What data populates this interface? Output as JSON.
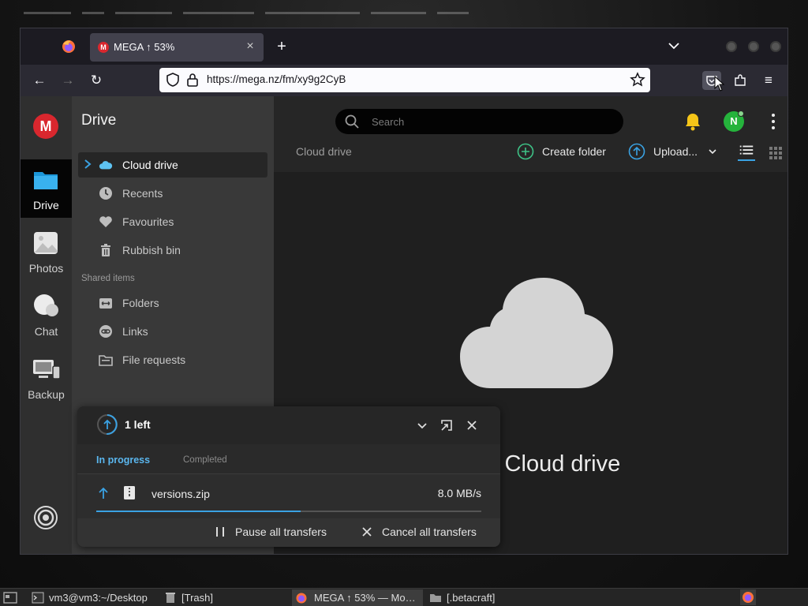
{
  "browser": {
    "tab_title": "MEGA ↑ 53%",
    "new_tab": "+",
    "url": "https://mega.nz/fm/xy9g2CyB"
  },
  "rail": {
    "logo": "M",
    "items": [
      {
        "label": "Drive",
        "active": true
      },
      {
        "label": "Photos"
      },
      {
        "label": "Chat"
      },
      {
        "label": "Backup"
      }
    ]
  },
  "sidebar": {
    "title": "Drive",
    "items": [
      {
        "label": "Cloud drive",
        "icon": "cloud-icon",
        "active": true
      },
      {
        "label": "Recents",
        "icon": "clock-icon"
      },
      {
        "label": "Favourites",
        "icon": "heart-icon"
      },
      {
        "label": "Rubbish bin",
        "icon": "trash-icon"
      }
    ],
    "shared_heading": "Shared items",
    "shared_items": [
      {
        "label": "Folders",
        "icon": "shared-folder-icon"
      },
      {
        "label": "Links",
        "icon": "link-icon"
      },
      {
        "label": "File requests",
        "icon": "file-request-icon"
      }
    ]
  },
  "topbar": {
    "search_placeholder": "Search",
    "avatar_initial": "N"
  },
  "toolbar": {
    "breadcrumb": "Cloud drive",
    "create_folder": "Create folder",
    "upload": "Upload..."
  },
  "empty_state": {
    "text": "y Cloud drive"
  },
  "transfers": {
    "count_text": "1 left",
    "tab_in_progress": "In progress",
    "tab_completed": "Completed",
    "file_name": "versions.zip",
    "speed": "8.0 MB/s",
    "progress": 0.53,
    "pause_all": "Pause all transfers",
    "cancel_all": "Cancel all transfers"
  },
  "taskbar": {
    "items": [
      {
        "label": "vm3@vm3:~/Desktop",
        "icon": "terminal-icon"
      },
      {
        "label": "[Trash]",
        "icon": "trash-icon"
      },
      {
        "label": "MEGA ↑ 53% — Mo…",
        "icon": "firefox-icon",
        "active": true
      },
      {
        "label": "[.betacraft]",
        "icon": "folder-icon"
      }
    ]
  },
  "colors": {
    "accent": "#3aa2e3",
    "brand_red": "#d9272e",
    "avatar_green": "#25b33c"
  }
}
